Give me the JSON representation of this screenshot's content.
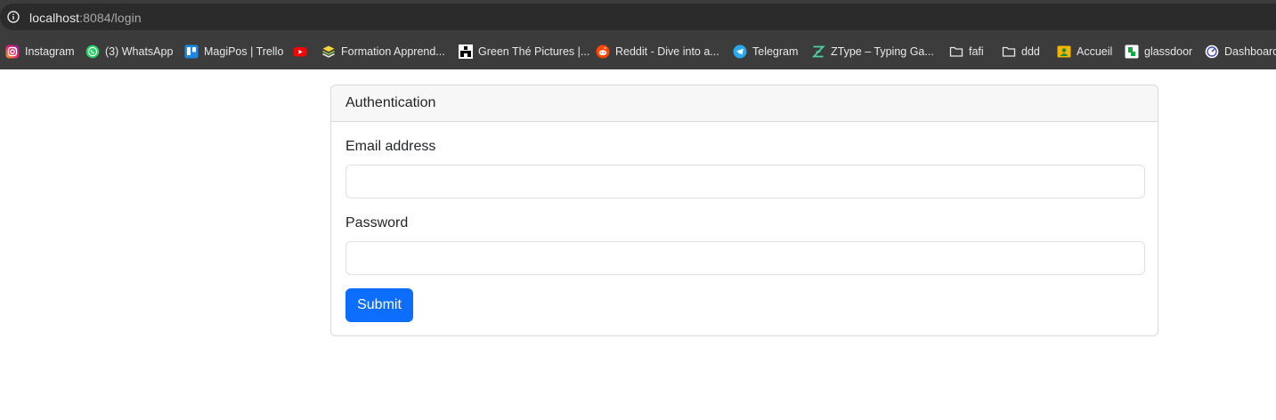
{
  "browser": {
    "url_host": "localhost",
    "url_rest": ":8084/login"
  },
  "bookmarks": [
    {
      "label": "Instagram",
      "icon": "instagram-icon"
    },
    {
      "label": "(3) WhatsApp",
      "icon": "whatsapp-icon"
    },
    {
      "label": "MagiPos | Trello",
      "icon": "trello-icon"
    },
    {
      "label": "",
      "icon": "youtube-icon"
    },
    {
      "label": "Formation Apprend...",
      "icon": "stack-icon"
    },
    {
      "label": "Green Thé Pictures |...",
      "icon": "pixel-logo-icon"
    },
    {
      "label": "Reddit - Dive into a...",
      "icon": "reddit-icon"
    },
    {
      "label": "Telegram",
      "icon": "telegram-icon"
    },
    {
      "label": "ZType – Typing Ga...",
      "icon": "ztype-icon"
    },
    {
      "label": "fafi",
      "icon": "folder-icon"
    },
    {
      "label": "ddd",
      "icon": "folder-icon"
    },
    {
      "label": "Accueil",
      "icon": "accueil-icon"
    },
    {
      "label": "glassdoor",
      "icon": "glassdoor-icon"
    },
    {
      "label": "Dashboard",
      "icon": "dashboard-icon"
    }
  ],
  "card": {
    "header": "Authentication",
    "email_label": "Email address",
    "email_value": "",
    "password_label": "Password",
    "password_value": "",
    "submit_label": "Submit"
  },
  "colors": {
    "primary": "#0d6efd",
    "chrome_bg": "#3c3c3c",
    "url_bg": "#2b2b2b",
    "card_header_bg": "#f7f7f7",
    "border": "#dee2e6"
  }
}
